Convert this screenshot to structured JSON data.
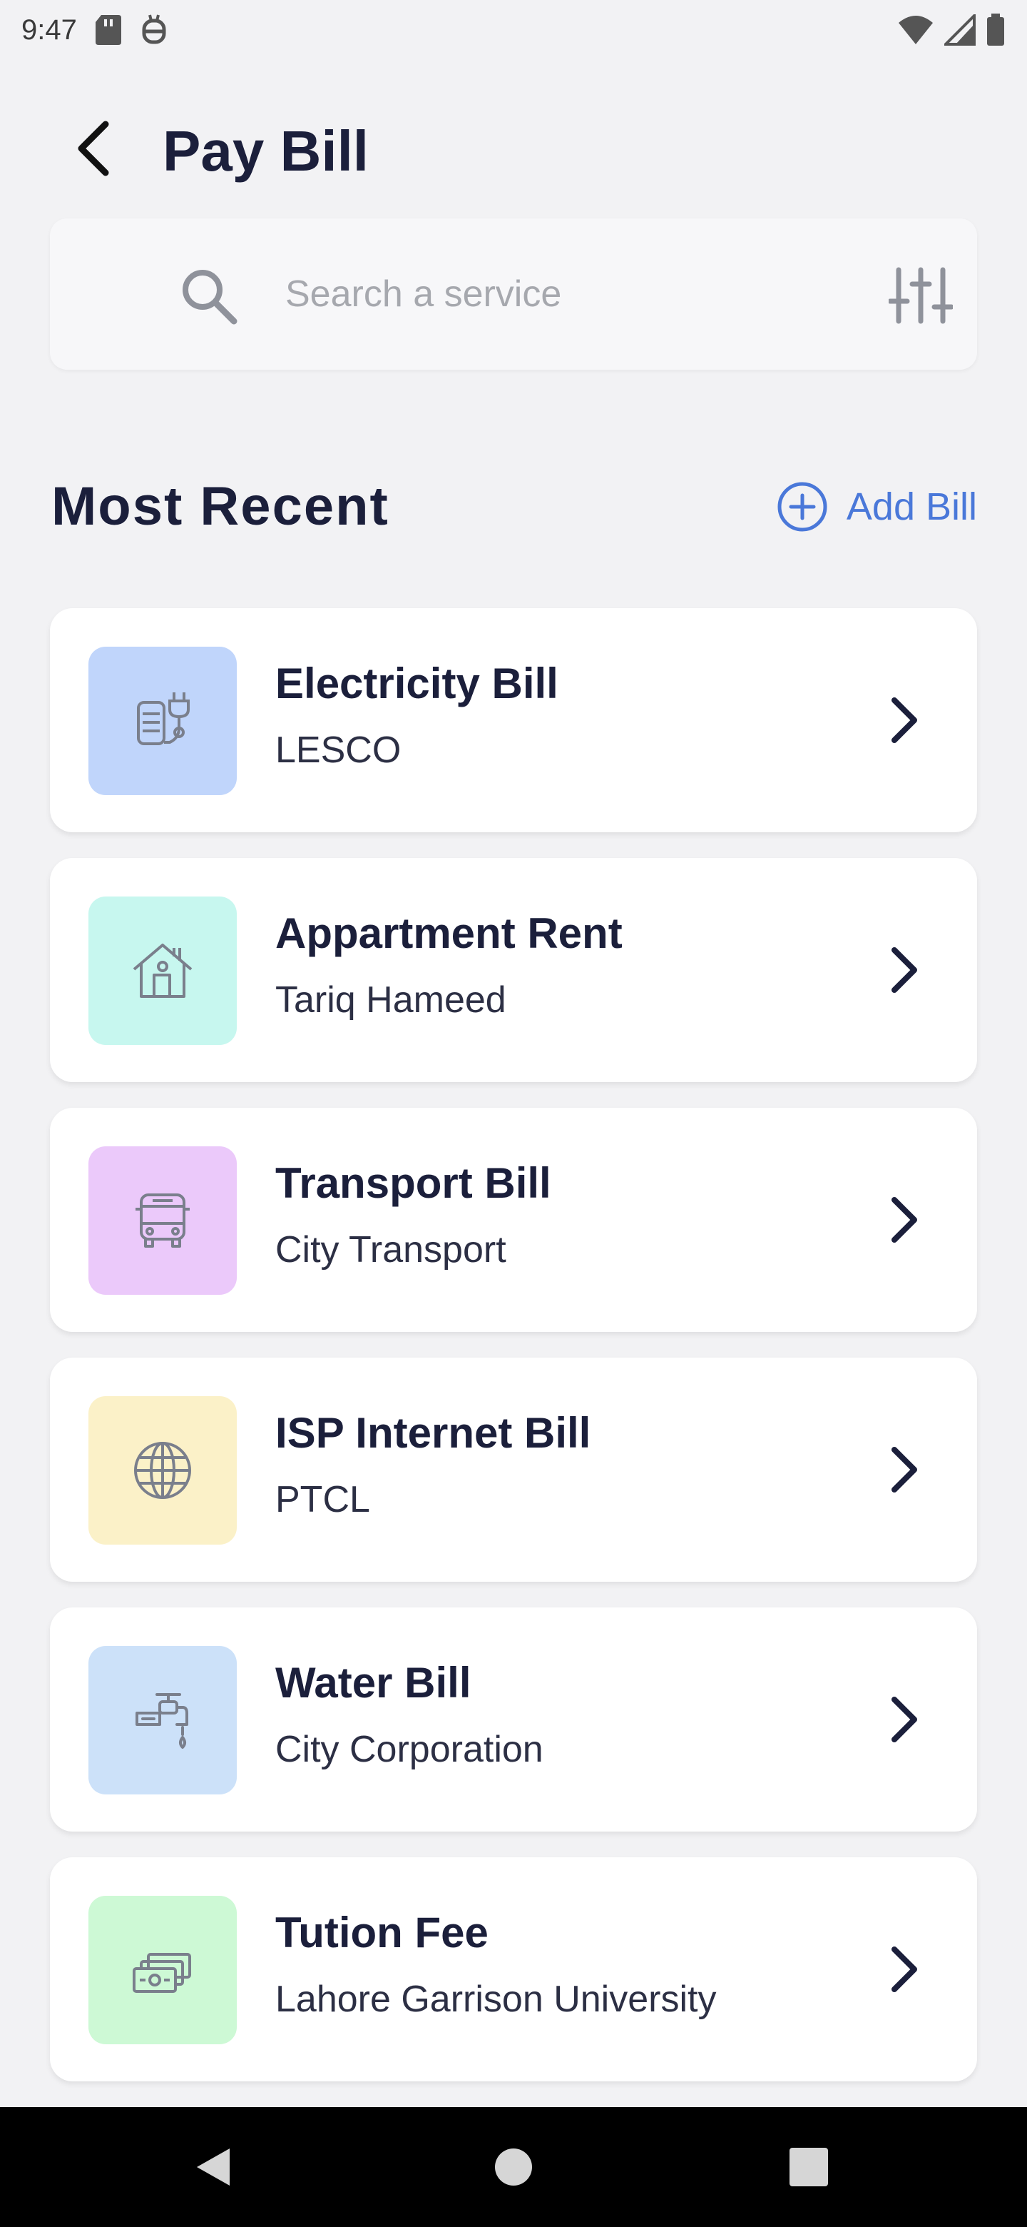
{
  "status_bar": {
    "time": "9:47"
  },
  "header": {
    "title": "Pay Bill",
    "back_icon": "back-arrow-icon"
  },
  "search": {
    "placeholder": "Search a service",
    "value": "",
    "search_icon": "search-icon",
    "filter_icon": "filter-sliders-icon"
  },
  "recent": {
    "title": "Most Recent",
    "add_label": "Add Bill",
    "accent_color": "#4a78d9"
  },
  "bills": [
    {
      "title": "Electricity Bill",
      "subtitle": "LESCO",
      "icon": "electricity-meter-icon",
      "color": "#c0d5fb"
    },
    {
      "title": "Appartment Rent",
      "subtitle": "Tariq Hameed",
      "icon": "house-icon",
      "color": "#c7f7ef"
    },
    {
      "title": "Transport Bill",
      "subtitle": "City Transport",
      "icon": "bus-icon",
      "color": "#ebc9fa"
    },
    {
      "title": "ISP Internet Bill",
      "subtitle": "PTCL",
      "icon": "globe-icon",
      "color": "#fbf1c8"
    },
    {
      "title": "Water Bill",
      "subtitle": "City Corporation",
      "icon": "water-tap-icon",
      "color": "#cce1f9"
    },
    {
      "title": "Tution Fee",
      "subtitle": "Lahore Garrison University",
      "icon": "cash-icon",
      "color": "#cdf9d5"
    }
  ]
}
